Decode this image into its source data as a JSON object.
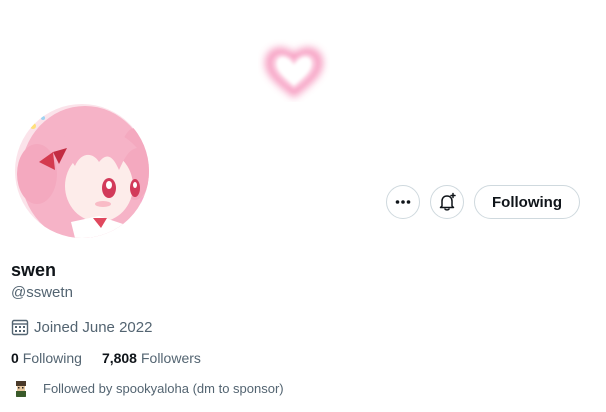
{
  "profile": {
    "name": "swen",
    "handle": "@sswetn",
    "joined": "Joined June 2022"
  },
  "actions": {
    "more_icon": "more-horizontal-icon",
    "notify_icon": "bell-plus-icon",
    "follow_label": "Following"
  },
  "stats": {
    "following_count": "0",
    "following_label": "Following",
    "followers_count": "7,808",
    "followers_label": "Followers"
  },
  "followed_by": {
    "text": "Followed by spookyaloha (dm to sponsor)"
  },
  "colors": {
    "text_primary": "#0f1419",
    "text_secondary": "#536471",
    "border": "#cfd9de",
    "heart": "#f7a8c8",
    "avatar_pink": "#f6b8c8"
  }
}
